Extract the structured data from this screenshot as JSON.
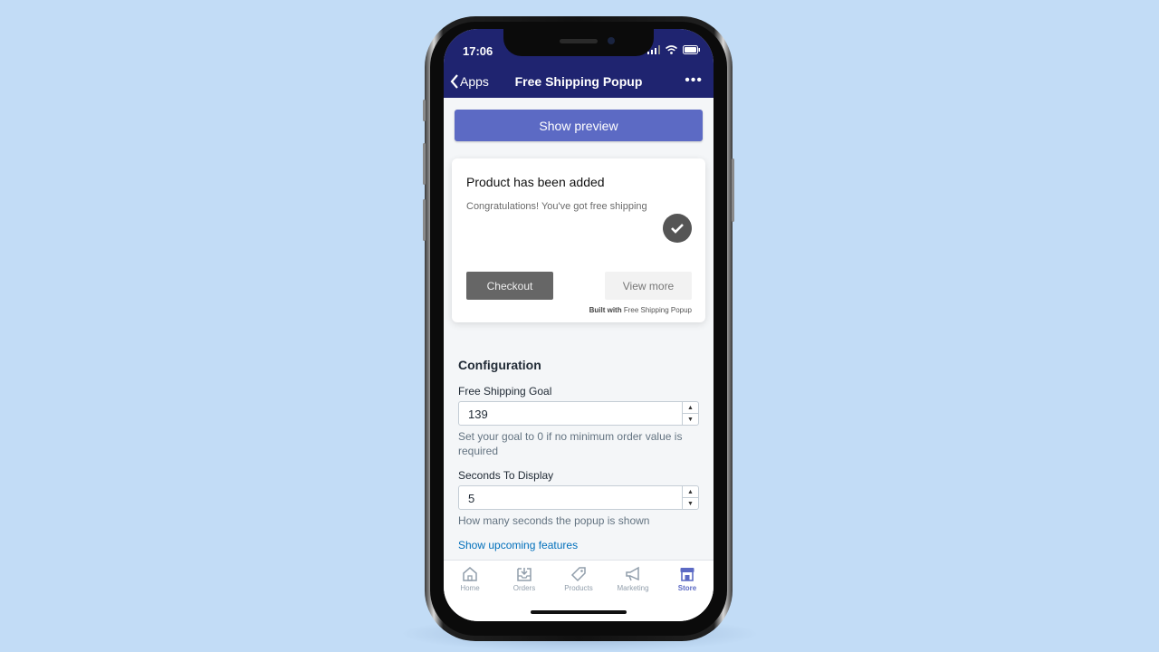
{
  "status_bar": {
    "time": "17:06"
  },
  "nav": {
    "back_label": "Apps",
    "title": "Free Shipping Popup",
    "more": "•••"
  },
  "preview_button": "Show preview",
  "popup_preview": {
    "title": "Product has been added",
    "message": "Congratulations! You've got free shipping",
    "checkout_label": "Checkout",
    "view_more_label": "View more",
    "built_with_prefix": "Built with",
    "built_with_name": "Free Shipping Popup"
  },
  "configuration": {
    "title": "Configuration",
    "fields": [
      {
        "label": "Free Shipping Goal",
        "value": "139",
        "help": "Set your goal to 0 if no minimum order value is required"
      },
      {
        "label": "Seconds To Display",
        "value": "5",
        "help": "How many seconds the popup is shown"
      }
    ],
    "upcoming_link": "Show upcoming features"
  },
  "tabbar": {
    "items": [
      {
        "label": "Home",
        "icon": "home-icon"
      },
      {
        "label": "Orders",
        "icon": "orders-icon"
      },
      {
        "label": "Products",
        "icon": "tag-icon"
      },
      {
        "label": "Marketing",
        "icon": "megaphone-icon"
      },
      {
        "label": "Store",
        "icon": "store-icon",
        "active": true
      }
    ]
  },
  "colors": {
    "nav_bg": "#1f2470",
    "accent": "#5c6ac4",
    "link": "#006fbb",
    "background": "#c2dcf6"
  }
}
